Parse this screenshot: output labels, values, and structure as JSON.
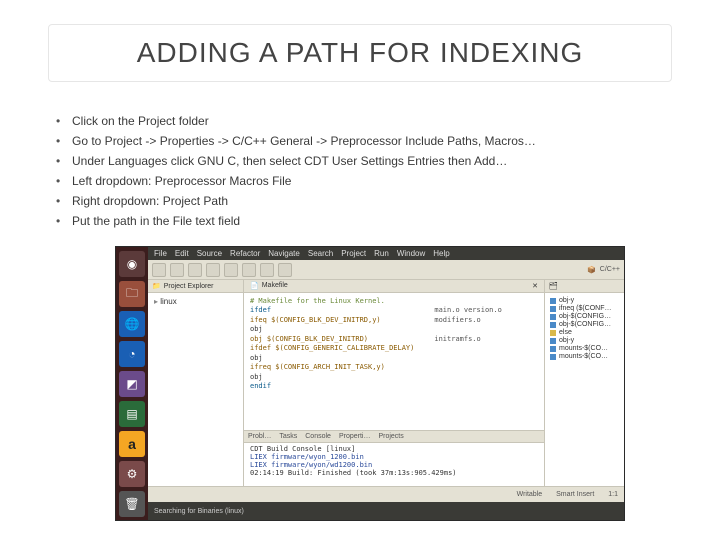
{
  "title": "ADDING A PATH FOR INDEXING",
  "bullets": [
    "Click on the Project folder",
    "Go to Project -> Properties -> C/C++ General -> Preprocessor Include Paths, Macros…",
    "Under Languages click GNU C, then select CDT  User Settings Entries then Add…",
    "Left dropdown: Preprocessor Macros File",
    "Right dropdown: Project Path",
    "Put the path in the File text field"
  ],
  "menubar": [
    "File",
    "Edit",
    "Source",
    "Refactor",
    "Navigate",
    "Search",
    "Project",
    "Run",
    "Window",
    "Help"
  ],
  "project_explorer": {
    "title": "Project Explorer",
    "node": "linux"
  },
  "editor": {
    "tab": "Makefile",
    "comment": "# Makefile for the Linux Kernel.",
    "lines": [
      "ifdef",
      " ifeq  $(CONFIG_BLK_DEV_INITRD,y)",
      "  obj",
      "  obj $(CONFIG_BLK_DEV_INITRD)",
      "  ifdef $(CONFIG_GENERIC_CALIBRATE_DELAY)",
      "  obj",
      "  ifreq $(CONFIG_ARCH_INIT_TASK,y)",
      "  obj",
      " endif"
    ],
    "right_cols": [
      "main.o version.o",
      "modifiers.o",
      "initramfs.o"
    ]
  },
  "console": {
    "tabs": [
      "Probl…",
      "Tasks",
      "Console",
      "Properti…",
      "Projects"
    ],
    "title": "CDT Build Console [linux]",
    "lines": [
      "LIEX    firmware/wyon_1200.bin",
      "LIEX    firmware/wyon/wd1200.bin"
    ],
    "summary": "02:14:19 Build: Finished (took 37m:13s:905.429ms)"
  },
  "outline": {
    "items": [
      {
        "sq": "b",
        "label": "obj-y"
      },
      {
        "sq": "b",
        "label": "ifneq ($(CONF…"
      },
      {
        "sq": "b",
        "label": "obj-$(CONFIG…"
      },
      {
        "sq": "b",
        "label": "obj-$(CONFIG…"
      },
      {
        "sq": "y",
        "label": "else"
      },
      {
        "sq": "b",
        "label": "obj-y"
      },
      {
        "sq": "b",
        "label": "mounts-$(CO…"
      },
      {
        "sq": "b",
        "label": "mounts-$(CO…"
      }
    ]
  },
  "perspective": "C/C++",
  "eclipse_status": {
    "left": "",
    "writable": "Writable",
    "insert": "Smart Insert",
    "pos": "1:1"
  },
  "ubuntu_status": "Searching for Binaries (linux)",
  "amazon_glyph": "a"
}
